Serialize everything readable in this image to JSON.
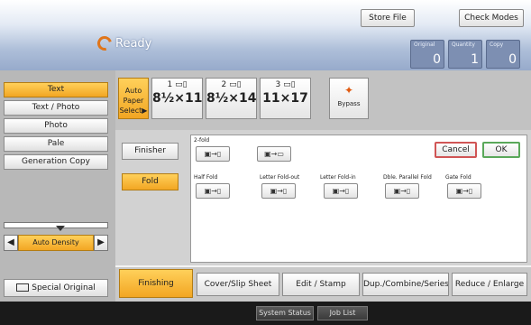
{
  "header": {
    "store_file": "Store File",
    "check_modes": "Check Modes",
    "status": "Ready",
    "counters": [
      {
        "label": "Original",
        "value": "0"
      },
      {
        "label": "Quantity",
        "value": "1"
      },
      {
        "label": "Copy",
        "value": "0"
      }
    ]
  },
  "modes": [
    "Text",
    "Text / Photo",
    "Photo",
    "Pale",
    "Generation Copy"
  ],
  "selected_mode": "Text",
  "density": {
    "left": "◀",
    "label": "Auto Density",
    "right": "▶"
  },
  "special_original": "Special Original",
  "paper": {
    "auto_line1": "Auto Paper",
    "auto_line2": "Select▶",
    "trays": [
      {
        "num": "1",
        "size": "8½×11"
      },
      {
        "num": "2",
        "size": "8½×14"
      },
      {
        "num": "3",
        "size": "11×17"
      }
    ],
    "bypass": "Bypass"
  },
  "side_tabs": {
    "finisher": "Finisher",
    "fold": "Fold"
  },
  "fold": {
    "two_fold_label": "2-fold",
    "options": [
      {
        "label": "Half Fold"
      },
      {
        "label": "Letter Fold-out"
      },
      {
        "label": "Letter Fold-in"
      },
      {
        "label": "Dble. Parallel Fold"
      },
      {
        "label": "Gate Fold"
      }
    ],
    "cancel": "Cancel",
    "ok": "OK"
  },
  "tabs": [
    "Finishing",
    "Cover/Slip Sheet",
    "Edit / Stamp",
    "Dup./Combine/Series",
    "Reduce / Enlarge"
  ],
  "active_tab": "Finishing",
  "status_bar": {
    "system_status": "System Status",
    "job_list": "Job List"
  },
  "colors": {
    "accent": "#f2a623",
    "header_blue": "#97aacb",
    "ready_icon": "#e0751a"
  }
}
